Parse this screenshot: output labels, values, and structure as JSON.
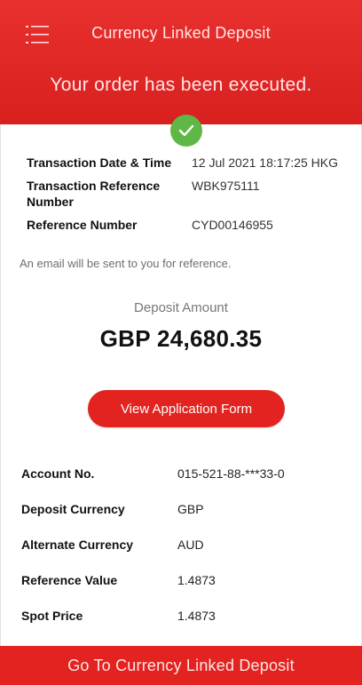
{
  "header": {
    "title": "Currency Linked Deposit",
    "status_message": "Your order has been executed."
  },
  "transaction": [
    {
      "label": "Transaction Date & Time",
      "value": "12 Jul 2021 18:17:25 HKG"
    },
    {
      "label": "Transaction Reference Number",
      "value": "WBK975111"
    },
    {
      "label": "Reference Number",
      "value": "CYD00146955"
    }
  ],
  "email_note": "An email will be sent to you for reference.",
  "deposit": {
    "label": "Deposit Amount",
    "amount": "GBP 24,680.35"
  },
  "view_application_button": "View Application Form",
  "details": [
    {
      "label": "Account No.",
      "value": "015-521-88-***33-0"
    },
    {
      "label": "Deposit Currency",
      "value": "GBP"
    },
    {
      "label": "Alternate Currency",
      "value": "AUD"
    },
    {
      "label": "Reference Value",
      "value": "1.4873"
    },
    {
      "label": "Spot Price",
      "value": "1.4873"
    }
  ],
  "footer_button": "Go To Currency Linked Deposit",
  "colors": {
    "brand_red": "#e2231f",
    "success_green": "#5fb745"
  },
  "icons": {
    "menu": "menu-icon",
    "success": "check-icon"
  }
}
